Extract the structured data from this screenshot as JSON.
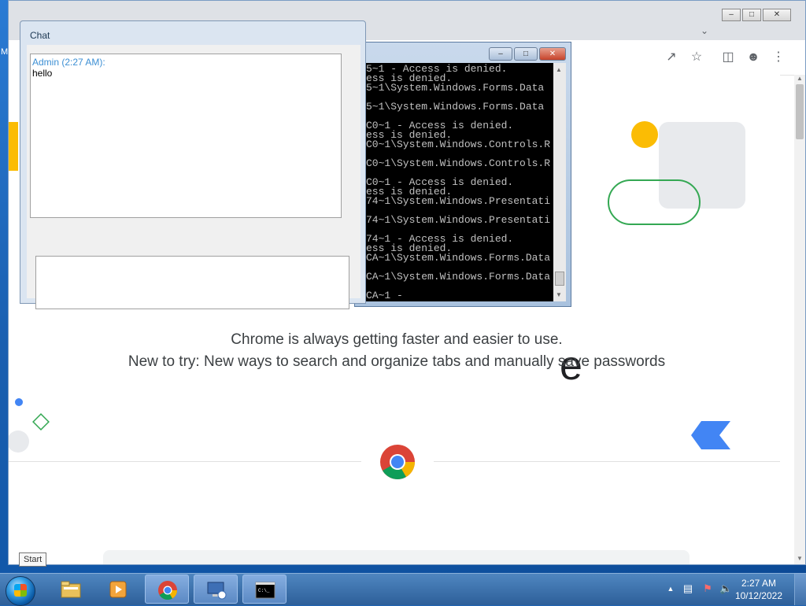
{
  "desktop": {
    "edge_label": "M"
  },
  "chat": {
    "title": "Chat",
    "messages": [
      {
        "sender": "Admin (2:27 AM):",
        "text": "hello"
      }
    ],
    "input_value": ""
  },
  "console": {
    "lines": [
      "5~1 - Access is denied.",
      "ess is denied.",
      "5~1\\System.Windows.Forms.Data",
      "",
      "5~1\\System.Windows.Forms.Data",
      "",
      "C0~1 - Access is denied.",
      "ess is denied.",
      "C0~1\\System.Windows.Controls.R",
      "",
      "C0~1\\System.Windows.Controls.R",
      "",
      "C0~1 - Access is denied.",
      "ess is denied.",
      "74~1\\System.Windows.Presentati",
      "",
      "74~1\\System.Windows.Presentati",
      "",
      "74~1 - Access is denied.",
      "ess is denied.",
      "CA~1\\System.Windows.Forms.Data",
      "",
      "CA~1\\System.Windows.Forms.Data",
      "",
      "CA~1 -"
    ]
  },
  "chrome": {
    "page": {
      "headline_fragment": "e",
      "line1": "Chrome is always getting faster and easier to use.",
      "line2": "New to try: New ways to search and organize tabs and manually save passwords"
    }
  },
  "taskbar": {
    "start_tooltip": "Start",
    "clock_time": "2:27 AM",
    "clock_date": "10/12/2022",
    "items": [
      "file-explorer",
      "media-player",
      "chrome",
      "remote-desktop",
      "command-prompt"
    ]
  }
}
